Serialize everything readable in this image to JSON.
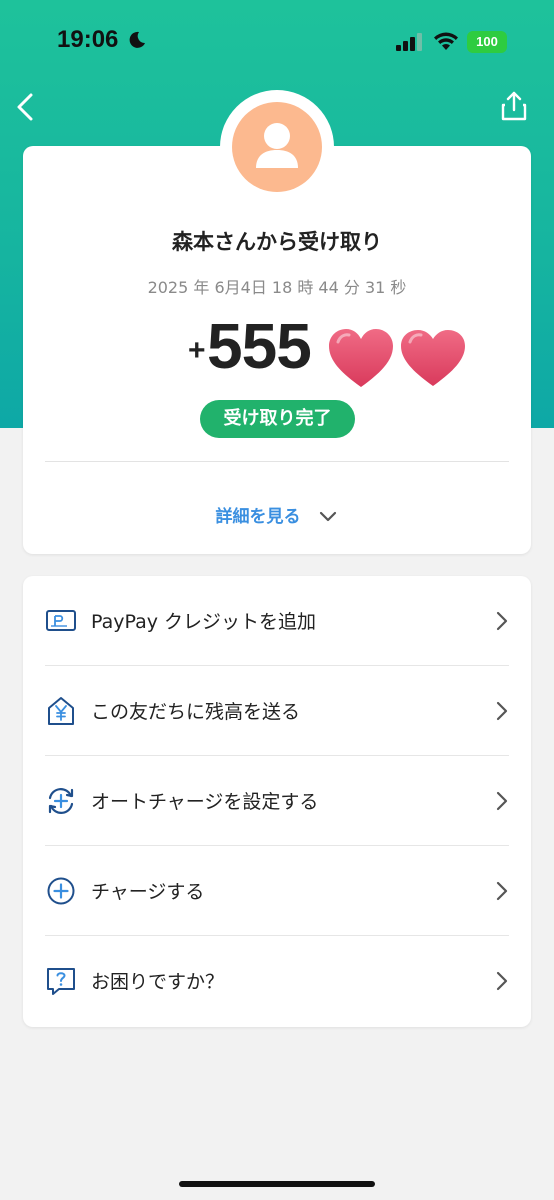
{
  "status_bar": {
    "time": "19:06",
    "battery": "100"
  },
  "header": {
    "back_icon": "chevron-left-icon",
    "share_icon": "share-icon"
  },
  "transaction": {
    "title": "森本さんから受け取り",
    "datetime": "2025 年 6月4日 18 時 44 分 31 秒",
    "sign": "+",
    "amount": "555",
    "status": "受け取り完了",
    "details_label": "詳細を見る"
  },
  "menu": [
    {
      "label": "PayPay クレジットを追加",
      "icon": "paypay-card-icon"
    },
    {
      "label": "この友だちに残高を送る",
      "icon": "yen-house-icon"
    },
    {
      "label": "オートチャージを設定する",
      "icon": "auto-charge-icon"
    },
    {
      "label": "チャージする",
      "icon": "plus-circle-icon"
    },
    {
      "label": "お困りですか？",
      "icon": "help-bubble-icon"
    }
  ],
  "colors": {
    "header_gradient_top": "#1ec29b",
    "header_gradient_bottom": "#0ea8a6",
    "badge_green": "#21b26c",
    "link_blue": "#3a8fe0",
    "avatar_orange": "#fcb98f",
    "heart_pink": "#e84a6a",
    "icon_navy": "#1f4f8c"
  }
}
